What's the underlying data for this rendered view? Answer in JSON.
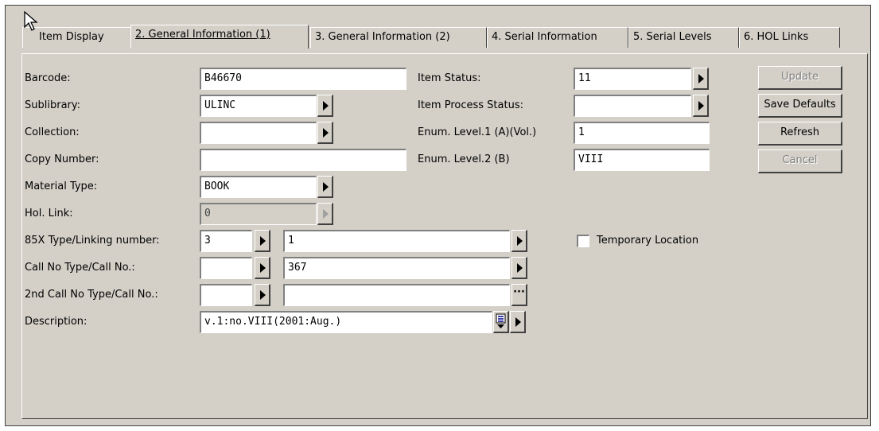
{
  "tabs": [
    {
      "label": "Item Display"
    },
    {
      "label": "2. General Information (1)"
    },
    {
      "label": "3. General Information (2)"
    },
    {
      "label": "4. Serial Information"
    },
    {
      "label": "5. Serial Levels"
    },
    {
      "label": "6. HOL Links"
    }
  ],
  "form": {
    "barcode": {
      "label": "Barcode:",
      "value": "B46670"
    },
    "sublibrary": {
      "label": "Sublibrary:",
      "value": "ULINC"
    },
    "collection": {
      "label": "Collection:",
      "value": ""
    },
    "copy_number": {
      "label": "Copy Number:",
      "value": ""
    },
    "material_type": {
      "label": "Material Type:",
      "value": "BOOK"
    },
    "hol_link": {
      "label": "Hol. Link:",
      "value": "0"
    },
    "linking": {
      "label": "85X Type/Linking number:",
      "type_value": "3",
      "number_value": "1"
    },
    "call_no": {
      "label": "Call No Type/Call No.:",
      "type_value": "",
      "number_value": "367"
    },
    "call_no_2": {
      "label": "2nd Call No Type/Call No.:",
      "type_value": "",
      "number_value": ""
    },
    "description": {
      "label": "Description:",
      "value": "v.1:no.VIII(2001:Aug.)"
    },
    "item_status": {
      "label": "Item Status:",
      "value": "11"
    },
    "item_process_status": {
      "label": "Item Process Status:",
      "value": ""
    },
    "enum_level_1": {
      "label": "Enum. Level.1 (A)(Vol.)",
      "value": "1"
    },
    "enum_level_2": {
      "label": "Enum. Level.2  (B)",
      "value": "VIII"
    },
    "temporary_location": {
      "label": "Temporary Location",
      "checked": false
    }
  },
  "buttons": {
    "update": "Update",
    "save_defaults": "Save Defaults",
    "refresh": "Refresh",
    "cancel": "Cancel"
  },
  "icons": {
    "arrow": "right-triangle-icon",
    "list": "list-scroll-icon",
    "ellipsis": "ellipsis-icon"
  }
}
